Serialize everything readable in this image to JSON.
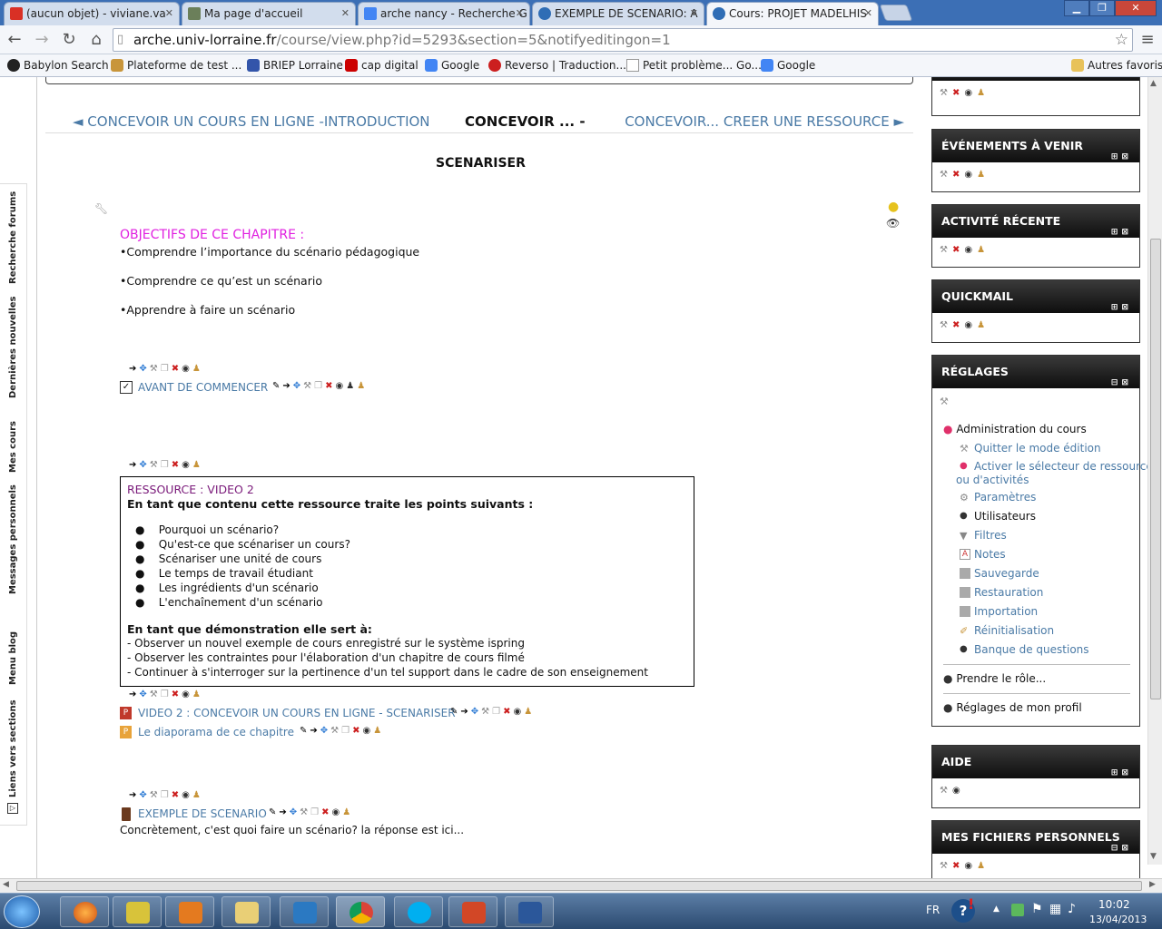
{
  "browser": {
    "tabs": [
      {
        "label": "(aucun objet) - viviane.va",
        "color": "#d93025"
      },
      {
        "label": "Ma page d'accueil",
        "color": "#6b7f5a"
      },
      {
        "label": "arche nancy - Recherche G",
        "color": "#4285f4"
      },
      {
        "label": "EXEMPLE DE SCENARIO: A",
        "color": "#2f6db5"
      },
      {
        "label": "Cours: PROJET MADELHIS",
        "color": "#2f6db5"
      }
    ],
    "url_host": "arche.univ-lorraine.fr",
    "url_path": "/course/view.php?id=5293&section=5&notifyeditingon=1",
    "bookmarks": [
      {
        "label": "Babylon Search",
        "color": "#222"
      },
      {
        "label": "Plateforme de test ...",
        "color": "#c8953a"
      },
      {
        "label": "BRIEP Lorraine",
        "color": "#3355aa"
      },
      {
        "label": "cap digital",
        "color": "#cc0000"
      },
      {
        "label": "Google",
        "color": "#4285f4"
      },
      {
        "label": "Reverso | Traduction...",
        "color": "#cc1f1f"
      },
      {
        "label": "Petit problème... Go...",
        "color": "#ffffff"
      },
      {
        "label": "Google",
        "color": "#4285f4"
      }
    ],
    "other_bookmarks": "Autres favoris"
  },
  "dock": [
    "Recherche forums",
    "Dernières nouvelles",
    "Mes cours",
    "Messages personnels",
    "Menu blog",
    "Liens vers sections"
  ],
  "section_nav": {
    "prev": "◄ CONCEVOIR UN COURS EN LIGNE -INTRODUCTION",
    "current": "CONCEVOIR ... -",
    "next": "CONCEVOIR... CREER UNE RESSOURCE ►"
  },
  "section_title": "SCENARISER",
  "objectives": {
    "heading": "OBJECTIFS DE CE CHAPITRE :",
    "items": [
      "•Comprendre l’importance du scénario pédagogique",
      "•Comprendre ce qu’est un scénario",
      "•Apprendre à faire un scénario"
    ]
  },
  "activities": {
    "avant": "AVANT DE COMMENCER",
    "video": "VIDEO 2 : CONCEVOIR UN COURS EN LIGNE - SCENARISER",
    "diaporama": "Le diaporama de ce chapitre",
    "exemple": "EXEMPLE DE SCENARIO",
    "exemple_desc": "Concrètement, c'est quoi faire un scénario? la réponse est ici..."
  },
  "resource": {
    "title": "RESSOURCE : VIDEO 2",
    "intro": "En tant que contenu cette ressource traite les points suivants :",
    "points": [
      "Pourquoi un scénario?",
      "Qu'est-ce que scénariser un cours?",
      "Scénariser une unité de cours",
      "Le temps de travail étudiant",
      "Les ingrédients d'un scénario",
      "L'enchaînement d'un scénario"
    ],
    "demo_heading": "En tant que démonstration elle sert à:",
    "demo_points": [
      "- Observer un nouvel exemple de  cours enregistré sur le système ispring",
      "- Observer les contraintes pour l'élaboration d'un chapitre de cours filmé",
      "- Continuer à s'interroger sur la pertinence d'un tel support dans le cadre de son enseignement"
    ]
  },
  "blocks": {
    "events": "ÉVÉNEMENTS À VENIR",
    "activity": "ACTIVITÉ RÉCENTE",
    "quickmail": "QUICKMAIL",
    "settings": "RÉGLAGES",
    "help": "AIDE",
    "files": "MES FICHIERS PERSONNELS"
  },
  "settings_menu": {
    "admin": "Administration du cours",
    "items": [
      {
        "label": "Quitter le mode édition",
        "link": true
      },
      {
        "label": "Activer le sélecteur de ressources",
        "link": true
      },
      {
        "label": "ou d'activités",
        "link": true
      },
      {
        "label": "Paramètres",
        "link": true
      },
      {
        "label": "Utilisateurs",
        "link": false
      },
      {
        "label": "Filtres",
        "link": true
      },
      {
        "label": "Notes",
        "link": true
      },
      {
        "label": "Sauvegarde",
        "link": true
      },
      {
        "label": "Restauration",
        "link": true
      },
      {
        "label": "Importation",
        "link": true
      },
      {
        "label": "Réinitialisation",
        "link": true
      },
      {
        "label": "Banque de questions",
        "link": true
      }
    ],
    "role": "Prendre le rôle...",
    "profile": "Réglages de mon profil"
  },
  "taskbar": {
    "lang": "FR",
    "time": "10:02",
    "date": "13/04/2013"
  },
  "colors": {
    "link": "#4a7aa6",
    "objectives": "#e020e0",
    "resource_title": "#7a1a7a"
  }
}
